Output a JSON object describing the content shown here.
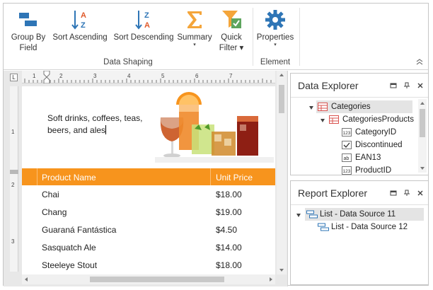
{
  "ribbon": {
    "buttons": [
      {
        "id": "group-by-field",
        "label_line1": "Group By",
        "label_line2": "Field",
        "icon": "group-by-field-icon"
      },
      {
        "id": "sort-ascending",
        "label_line1": "Sort Ascending",
        "label_line2": "",
        "icon": "sort-ascending-icon"
      },
      {
        "id": "sort-descending",
        "label_line1": "Sort Descending",
        "label_line2": "",
        "icon": "sort-descending-icon"
      },
      {
        "id": "summary",
        "label_line1": "Summary",
        "label_line2": "▾",
        "icon": "summary-icon"
      },
      {
        "id": "quick-filter",
        "label_line1": "Quick",
        "label_line2": "Filter ▾",
        "icon": "quick-filter-icon"
      },
      {
        "id": "properties",
        "label_line1": "Properties",
        "label_line2": "▾",
        "icon": "gear-icon"
      }
    ],
    "groups": [
      {
        "label": "Data Shaping"
      },
      {
        "label": "Element"
      }
    ],
    "colors": {
      "blue": "#2e75b6",
      "orange": "#f4a53a",
      "green": "#5ea55e"
    }
  },
  "designer": {
    "ruler_corner": "L",
    "ruler_marks": [
      "1",
      "2",
      "3",
      "4",
      "5",
      "6",
      "7"
    ],
    "vruler_marks": [
      "1",
      "2",
      "3"
    ],
    "header_text": "Soft drinks, coffees, teas, beers, and ales",
    "table": {
      "columns": [
        "Product Name",
        "Unit Price"
      ],
      "rows": [
        [
          "Chai",
          "$18.00"
        ],
        [
          "Chang",
          "$19.00"
        ],
        [
          "Guaraná Fantástica",
          "$4.50"
        ],
        [
          "Sasquatch Ale",
          "$14.00"
        ],
        [
          "Steeleye Stout",
          "$18.00"
        ]
      ],
      "header_color": "#f7941d"
    }
  },
  "data_explorer": {
    "title": "Data Explorer",
    "items": [
      {
        "label": "Categories",
        "icon": "table-icon",
        "selected": true
      },
      {
        "label": "CategoriesProducts",
        "icon": "table-icon",
        "selected": false
      },
      {
        "label": "CategoryID",
        "icon": "number-field-icon",
        "selected": false
      },
      {
        "label": "Discontinued",
        "icon": "boolean-field-icon",
        "selected": false
      },
      {
        "label": "EAN13",
        "icon": "text-field-icon",
        "selected": false
      },
      {
        "label": "ProductID",
        "icon": "number-field-icon",
        "selected": false
      }
    ]
  },
  "report_explorer": {
    "title": "Report Explorer",
    "items": [
      {
        "label": "List - Data Source 11",
        "icon": "list-icon",
        "selected": true
      },
      {
        "label": "List - Data Source 12",
        "icon": "list-icon",
        "selected": false
      }
    ]
  }
}
